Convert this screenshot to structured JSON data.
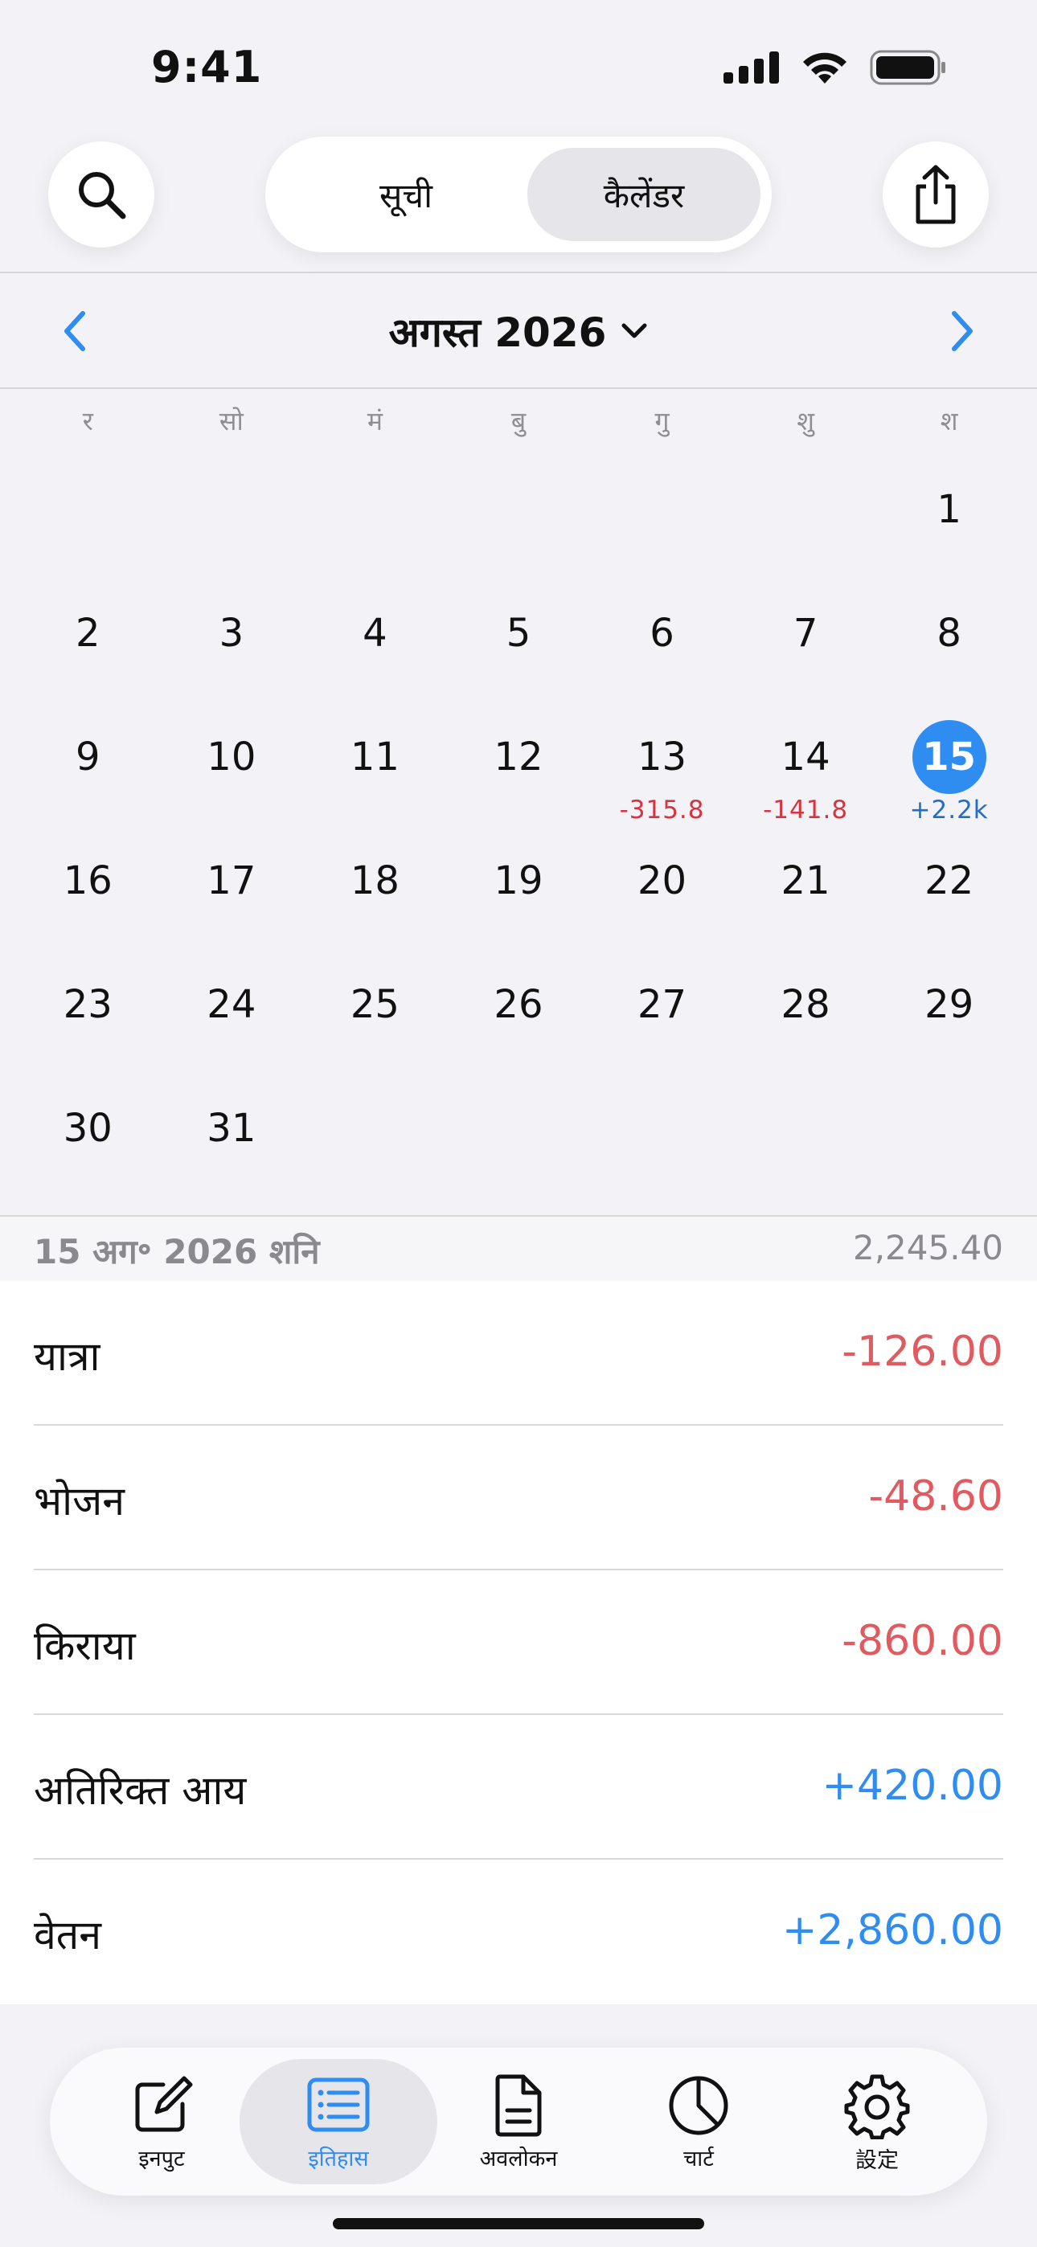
{
  "status_bar": {
    "time": "9:41"
  },
  "header": {
    "segments": [
      {
        "label": "सूची",
        "active": false
      },
      {
        "label": "कैलेंडर",
        "active": true
      }
    ],
    "icons": {
      "search": "search-icon",
      "share": "share-icon"
    }
  },
  "calendar": {
    "month_title": "अगस्त 2026",
    "weekdays": [
      "र",
      "सो",
      "मं",
      "बु",
      "गु",
      "शु",
      "श"
    ],
    "weeks": [
      [
        {
          "d": ""
        },
        {
          "d": ""
        },
        {
          "d": ""
        },
        {
          "d": ""
        },
        {
          "d": ""
        },
        {
          "d": ""
        },
        {
          "d": "1"
        }
      ],
      [
        {
          "d": "2"
        },
        {
          "d": "3"
        },
        {
          "d": "4"
        },
        {
          "d": "5"
        },
        {
          "d": "6"
        },
        {
          "d": "7"
        },
        {
          "d": "8"
        }
      ],
      [
        {
          "d": "9"
        },
        {
          "d": "10"
        },
        {
          "d": "11"
        },
        {
          "d": "12"
        },
        {
          "d": "13",
          "amt": "-315.8",
          "sign": "neg"
        },
        {
          "d": "14",
          "amt": "-141.8",
          "sign": "neg"
        },
        {
          "d": "15",
          "amt": "+2.2k",
          "sign": "pos",
          "selected": true
        }
      ],
      [
        {
          "d": "16"
        },
        {
          "d": "17"
        },
        {
          "d": "18"
        },
        {
          "d": "19"
        },
        {
          "d": "20"
        },
        {
          "d": "21"
        },
        {
          "d": "22"
        }
      ],
      [
        {
          "d": "23"
        },
        {
          "d": "24"
        },
        {
          "d": "25"
        },
        {
          "d": "26"
        },
        {
          "d": "27"
        },
        {
          "d": "28"
        },
        {
          "d": "29"
        }
      ],
      [
        {
          "d": "30"
        },
        {
          "d": "31"
        },
        {
          "d": ""
        },
        {
          "d": ""
        },
        {
          "d": ""
        },
        {
          "d": ""
        },
        {
          "d": ""
        }
      ]
    ]
  },
  "summary": {
    "date": "15 अग॰ 2026 शनि",
    "total": "2,245.40",
    "entries": [
      {
        "label": "यात्रा",
        "value": "-126.00",
        "type": "expense"
      },
      {
        "label": "भोजन",
        "value": "-48.60",
        "type": "expense"
      },
      {
        "label": "किराया",
        "value": "-860.00",
        "type": "expense"
      },
      {
        "label": "अतिरिक्त आय",
        "value": "+420.00",
        "type": "income"
      },
      {
        "label": "वेतन",
        "value": "+2,860.00",
        "type": "income"
      }
    ]
  },
  "tabbar": {
    "tabs": [
      {
        "label": "इनपुट",
        "icon": "edit-icon"
      },
      {
        "label": "इतिहास",
        "icon": "list-icon",
        "active": true
      },
      {
        "label": "अवलोकन",
        "icon": "document-icon"
      },
      {
        "label": "चार्ट",
        "icon": "pie-chart-icon"
      },
      {
        "label": "設定",
        "icon": "gear-icon"
      }
    ]
  },
  "colors": {
    "accent": "#2f8cf0",
    "expense": "#e05a5f",
    "income": "#2f8cf0"
  }
}
